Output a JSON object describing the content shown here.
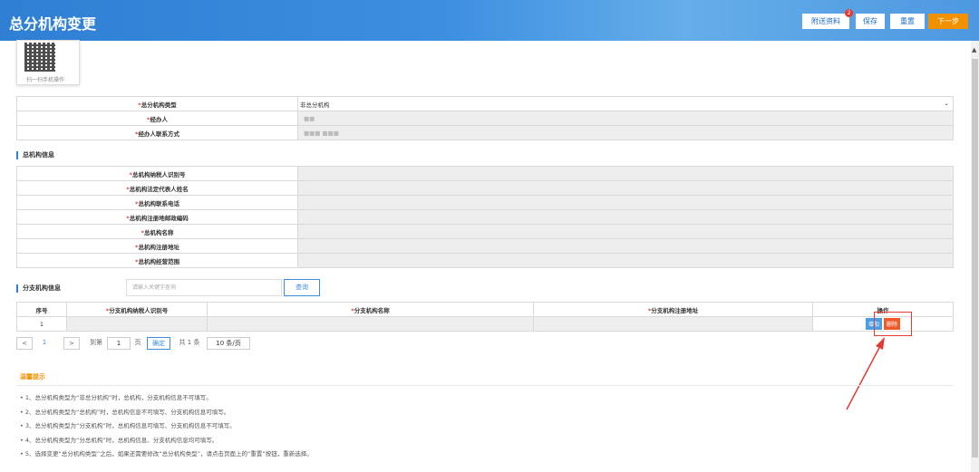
{
  "header": {
    "title": "总分机构变更",
    "buttons": {
      "attach": "附送资料",
      "attach_badge": "2",
      "save": "保存",
      "reset": "重置",
      "next": "下一步"
    }
  },
  "qr": {
    "caption": "扫一扫手机操作"
  },
  "base_form": {
    "rows": [
      {
        "label": "总分机构类型",
        "value": "非总分机构"
      },
      {
        "label": "经办人",
        "value": "■■"
      },
      {
        "label": "经办人联系方式",
        "value": "■■■ ■■■"
      }
    ]
  },
  "head_office": {
    "section_title": "总机构信息",
    "rows": [
      {
        "label": "总机构纳税人识别号"
      },
      {
        "label": "总机构法定代表人姓名"
      },
      {
        "label": "总机构联系电话"
      },
      {
        "label": "总机构注册地邮政编码"
      },
      {
        "label": "总机构名称"
      },
      {
        "label": "总机构注册地址"
      },
      {
        "label": "总机构经营范围"
      }
    ]
  },
  "branch": {
    "section_title": "分支机构信息",
    "search_placeholder": "请输入关键字查询",
    "query_button": "查询",
    "columns": [
      "序号",
      "分支机构纳税人识别号",
      "分支机构名称",
      "分支机构注册地址",
      "操作"
    ],
    "rows": [
      {
        "index": "1",
        "add": "增加",
        "delete": "删除"
      }
    ]
  },
  "pager": {
    "prev": "<",
    "page": "1",
    "next": ">",
    "goto_label": "到第",
    "goto_value": "1",
    "page_unit": "页",
    "confirm": "确定",
    "total": "共 1 条",
    "per_page": "10 条/页"
  },
  "tips": {
    "title": "温馨提示",
    "items": [
      "1、总分机构类型为“非总分机构”时，总机构，分支机构信息不可填写。",
      "2、总分机构类型为“总机构”时，总机构信息不可填写、分支机构信息可填写。",
      "3、总分机构类型为“分支机构”时，总机构信息可填写、分支机构信息不可填写。",
      "4、总分机构类型为“分总机构”时，总机构信息、分支机构信息均可填写。",
      "5、选择变更“总分机构类型”之后，如果还需要修改“总分机构类型”，请点击页面上的“重置”按钮，重新选择。"
    ]
  }
}
